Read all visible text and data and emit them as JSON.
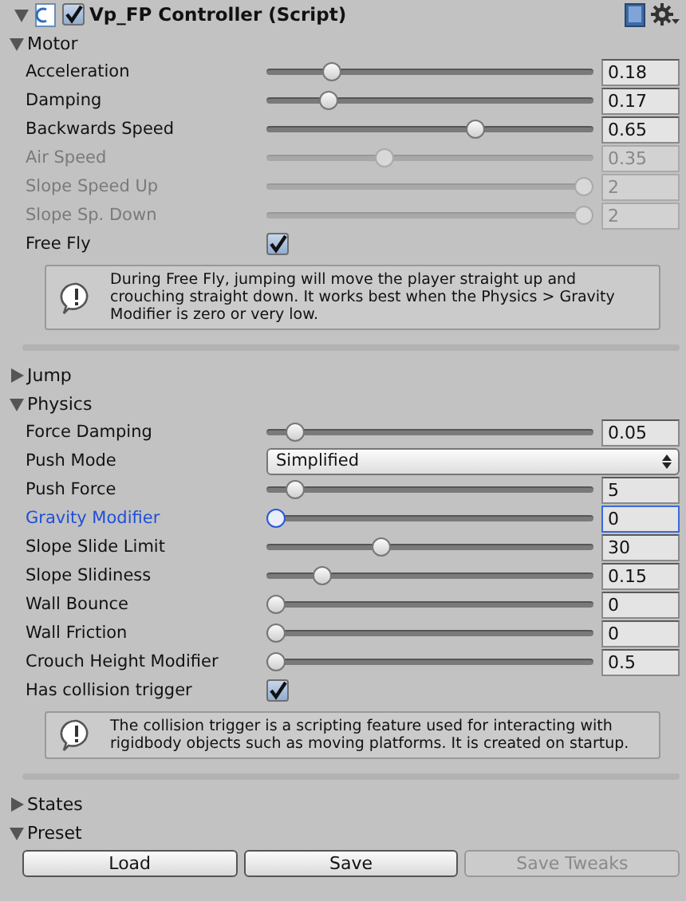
{
  "component": {
    "title": "Vp_FP Controller (Script)",
    "enabled": true
  },
  "sections": [
    {
      "label": "Motor",
      "expanded": true,
      "rows": [
        {
          "kind": "slider",
          "label": "Acceleration",
          "level": 0.18,
          "value": "0.18",
          "disabled": false,
          "focused": false
        },
        {
          "kind": "slider",
          "label": "Damping",
          "level": 0.17,
          "value": "0.17",
          "disabled": false,
          "focused": false
        },
        {
          "kind": "slider",
          "label": "Backwards Speed",
          "level": 0.65,
          "value": "0.65",
          "disabled": false,
          "focused": false
        },
        {
          "kind": "slider",
          "label": "Air Speed",
          "level": 0.35,
          "value": "0.35",
          "disabled": true,
          "focused": false
        },
        {
          "kind": "slider",
          "label": "Slope Speed Up",
          "level": 1,
          "value": "2",
          "disabled": true,
          "focused": false
        },
        {
          "kind": "slider",
          "label": "Slope Sp. Down",
          "level": 1,
          "value": "2",
          "disabled": true,
          "focused": false
        },
        {
          "kind": "checkbox",
          "label": "Free Fly",
          "checked": true
        },
        {
          "kind": "help",
          "text": "During Free Fly, jumping will move the player straight up and crouching straight down. It works best when the Physics > Gravity Modifier is zero or very low."
        },
        {
          "kind": "separator"
        }
      ]
    },
    {
      "label": "Jump",
      "expanded": false
    },
    {
      "label": "Physics",
      "expanded": true,
      "rows": [
        {
          "kind": "slider",
          "label": "Force Damping",
          "level": 0.06,
          "value": "0.05",
          "disabled": false,
          "focused": false
        },
        {
          "kind": "dropdown",
          "label": "Push Mode",
          "value": "Simplified"
        },
        {
          "kind": "slider",
          "label": "Push Force",
          "level": 0.06,
          "value": "5",
          "disabled": false,
          "focused": false
        },
        {
          "kind": "slider",
          "label": "Gravity Modifier",
          "level": 0,
          "value": "0",
          "disabled": false,
          "focused": true
        },
        {
          "kind": "slider",
          "label": "Slope Slide Limit",
          "level": 0.34,
          "value": "30",
          "disabled": false,
          "focused": false
        },
        {
          "kind": "slider",
          "label": "Slope Slidiness",
          "level": 0.15,
          "value": "0.15",
          "disabled": false,
          "focused": false
        },
        {
          "kind": "slider",
          "label": "Wall Bounce",
          "level": 0,
          "value": "0",
          "disabled": false,
          "focused": false
        },
        {
          "kind": "slider",
          "label": "Wall Friction",
          "level": 0,
          "value": "0",
          "disabled": false,
          "focused": false
        },
        {
          "kind": "slider",
          "label": "Crouch Height Modifier",
          "level": 0,
          "value": "0.5",
          "disabled": false,
          "focused": false
        },
        {
          "kind": "checkbox",
          "label": "Has collision trigger",
          "checked": true
        },
        {
          "kind": "help",
          "text": "The collision trigger is a scripting feature used for interacting with rigidbody objects such as moving platforms. It is created on startup."
        },
        {
          "kind": "separator"
        }
      ]
    },
    {
      "label": "States",
      "expanded": false
    },
    {
      "label": "Preset",
      "expanded": true,
      "rows": [
        {
          "kind": "buttons",
          "buttons": [
            {
              "label": "Load",
              "disabled": false
            },
            {
              "label": "Save",
              "disabled": false
            },
            {
              "label": "Save Tweaks",
              "disabled": true
            }
          ]
        }
      ]
    }
  ]
}
